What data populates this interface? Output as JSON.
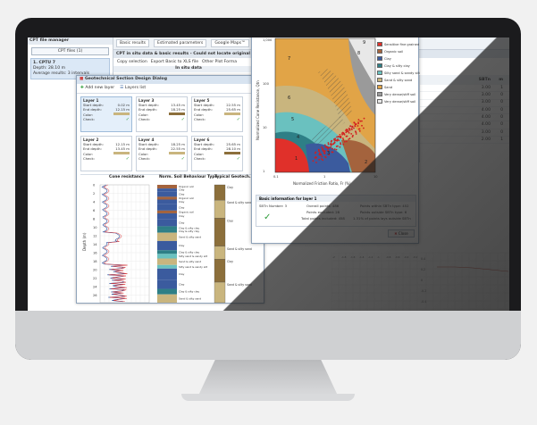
{
  "cpt_manager": {
    "title": "CPT file manager",
    "files_button": "CPT files (1)",
    "item": {
      "name": "1. CPTU 7",
      "depth": "Depth: 28.10 m",
      "avg": "Average results: 3 intervals"
    }
  },
  "topbar": {
    "tabs": [
      "Basic results",
      "Estimated parameters",
      "Google Maps™"
    ],
    "subbar": "CPT in situ data & basic results - Could not locate original file lo",
    "toolbar": [
      "Copy selection",
      "Export Basic to XLS file",
      "Other Plot Forma"
    ],
    "insitu_header": "In situ data"
  },
  "dialog": {
    "title": "Geotechnical Section Design Dialog",
    "add_layer": "Add new layer",
    "layers_list": "Layers list",
    "labels": {
      "start": "Start depth:",
      "end": "End depth:",
      "color": "Color:",
      "check": "Check:"
    },
    "layers": [
      {
        "name": "Layer 1",
        "start": "0.02 m",
        "end": "12.15 m",
        "color": "#c9b57e"
      },
      {
        "name": "Layer 3",
        "start": "13.45 m",
        "end": "18.25 m",
        "color": "#8c6f3b"
      },
      {
        "name": "Layer 5",
        "start": "22.55 m",
        "end": "25.65 m",
        "color": "#c9b57e"
      },
      {
        "name": "Layer 2",
        "start": "12.15 m",
        "end": "13.45 m",
        "color": "#c9b57e"
      },
      {
        "name": "Layer 4",
        "start": "18.25 m",
        "end": "22.55 m",
        "color": "#c9b57e"
      },
      {
        "name": "Layer 6",
        "start": "25.65 m",
        "end": "28.10 m",
        "color": "#8c6f3b"
      }
    ],
    "plots": {
      "cone_title": "Cone resistance",
      "sbt_title": "Norm. Soil Behaviour Type",
      "typical_title": "Typical Geotech. S",
      "depth_label": "Depth (m)",
      "depth_ticks": [
        "0",
        "2",
        "4",
        "6",
        "8",
        "10",
        "12",
        "14",
        "16",
        "18",
        "20",
        "22",
        "24",
        "26"
      ],
      "sbt_labels": [
        "Organic soil",
        "Clay",
        "Clay",
        "Organic soil",
        "Clay",
        "Clay",
        "Organic soil",
        "Clay",
        "Clay",
        "Clay & silty clay",
        "Clay & silty clay",
        "Sand & silty sand",
        "Clay",
        "Clay & silty clay",
        "Silty sand & sandy silt",
        "Sand & silty sand",
        "Silty sand & sandy silt",
        "Clay",
        "Clay",
        "Clay & silty clay",
        "Sand & silty sand"
      ],
      "typical_labels": [
        "Clay",
        "Sand & silty sand",
        "Clay",
        "Sand & silty sand",
        "Clay",
        "Sand & silty sand"
      ]
    }
  },
  "chart_window": {
    "ylabel": "Normalized Cone Resistance, Qtn",
    "xlabel": "Normalized Friction Ratio, Fr (%)",
    "y_ticks": [
      "1,000",
      "100",
      "10",
      "1"
    ],
    "x_ticks": [
      "0.1",
      "1",
      "10"
    ],
    "zones": [
      "1",
      "2",
      "3",
      "4",
      "5",
      "6",
      "7",
      "8",
      "9"
    ],
    "legend": [
      {
        "label": "Sensitive fine grained",
        "color": "#e0302a"
      },
      {
        "label": "Organic soil",
        "color": "#a4633d"
      },
      {
        "label": "Clay",
        "color": "#3b5b9e"
      },
      {
        "label": "Clay & silty clay",
        "color": "#2e7f86"
      },
      {
        "label": "Silty sand & sandy silt",
        "color": "#6ac1bf"
      },
      {
        "label": "Sand & silty sand",
        "color": "#c9b57e"
      },
      {
        "label": "Sand",
        "color": "#e1a447"
      },
      {
        "label": "Very dense/stiff soil",
        "color": "#9a9a9a"
      },
      {
        "label": "Very dense/stiff soil",
        "color": "#e8e8e8"
      }
    ],
    "basic_info": {
      "header": "Basic information for layer 1",
      "sbtn": "SBTn Number: 3",
      "overall": "Overall points: 486",
      "excluded": "Points excluded: 28",
      "included": "Total points included: 458",
      "within": "Points within SBTn type: 452",
      "outside": "Points outside SBTn type: 6",
      "percent": "1.31% of points lays outside SBTn"
    },
    "close_label": "Close"
  },
  "right_table": {
    "headers": [
      "SBTn",
      "m"
    ],
    "rows": [
      [
        "3.00",
        "1"
      ],
      [
        "3.00",
        "0"
      ],
      [
        "3.00",
        "0"
      ],
      [
        "4.00",
        "0"
      ],
      [
        "4.00",
        "0"
      ],
      [
        "4.00",
        "0"
      ],
      [
        "3.00",
        "0"
      ],
      [
        "2.00",
        "1"
      ]
    ]
  },
  "right_chart": {
    "x_ticks": [
      "-0.4",
      "-0.2",
      "0",
      "0.2",
      "0.4",
      "0.6",
      "0.8",
      "1",
      "1.2",
      "1.4",
      "1.6",
      "1.8",
      "2"
    ],
    "y_ticks": [
      "0.4",
      "0.2",
      "0",
      "-0.2",
      "-0.4"
    ]
  },
  "bottom_chart_ticks": [
    "-2",
    "-1.8",
    "-1.6",
    "-1.4",
    "-1.2",
    "-1",
    "-0.8",
    "-0.6",
    "-0.4",
    "-0.2"
  ]
}
